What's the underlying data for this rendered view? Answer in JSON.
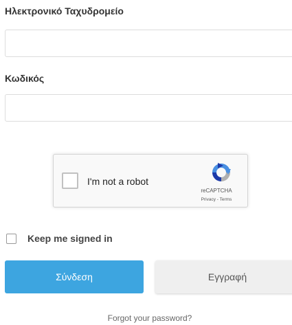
{
  "form": {
    "email_label": "Ηλεκτρονικό Ταχυδρομείο",
    "email_value": "",
    "email_placeholder": "",
    "password_label": "Κωδικός",
    "password_value": "",
    "password_placeholder": ""
  },
  "recaptcha": {
    "checkbox_label": "I'm not a robot",
    "brand": "reCAPTCHA",
    "privacy_link": "Privacy",
    "separator": " - ",
    "terms_link": "Terms",
    "icon": "recaptcha-logo-icon"
  },
  "keep_signed_in": {
    "label": "Keep me signed in",
    "checked": false
  },
  "buttons": {
    "login_label": "Σύνδεση",
    "register_label": "Εγγραφή"
  },
  "forgot_password": "Forgot your password?",
  "colors": {
    "primary": "#3da5e0",
    "secondary": "#efefef",
    "recaptcha_blue": "#4a90e2",
    "recaptcha_gray": "#b0b0b0"
  }
}
